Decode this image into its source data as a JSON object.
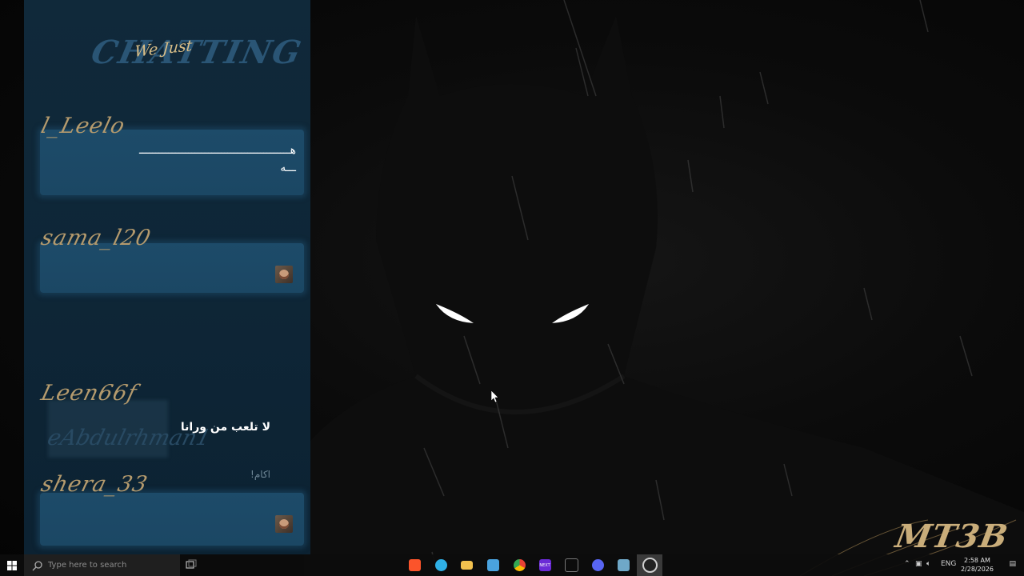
{
  "overlay": {
    "header_title_bg": "CHATTING",
    "header_title_fg": "We Just"
  },
  "messages": [
    {
      "username": "l_Leelo",
      "text": "هــــــــــــــــــــــــــــــــــــــــــــــ",
      "text2": "ـــه"
    },
    {
      "username": "sama_l20",
      "sticker": "user-face-sticker"
    },
    {
      "username": "Leen66f",
      "text": "لا تلعب من ورانا",
      "ghost_username": "eAbdulrhman1",
      "ghost_text": "اكام!"
    },
    {
      "username": "shera_33",
      "sticker": "user-face-sticker"
    }
  ],
  "desktop": {
    "wallpaper_subject": "batman-silhouette",
    "signature": "MT3B"
  },
  "taskbar": {
    "search_placeholder": "Type here to search",
    "apps": [
      {
        "name": "brave-icon",
        "color": "#fb542b"
      },
      {
        "name": "edge-icon",
        "color": "#2fb0e6"
      },
      {
        "name": "file-explorer-icon",
        "color": "#f2c14e"
      },
      {
        "name": "store-icon",
        "color": "#4aa3df"
      },
      {
        "name": "chrome-icon",
        "color": "#e94235"
      },
      {
        "name": "next-app-icon",
        "color": "#6b2bd6",
        "label": "NEXT"
      },
      {
        "name": "xbox-app-icon",
        "color": "#777777"
      },
      {
        "name": "discord-icon",
        "color": "#5865f2"
      },
      {
        "name": "notepad-icon",
        "color": "#6fa8c8"
      },
      {
        "name": "obs-icon",
        "color": "#d0d0d0"
      }
    ],
    "language": "ENG",
    "time": "2:58 AM",
    "date": "2/28/2026"
  }
}
